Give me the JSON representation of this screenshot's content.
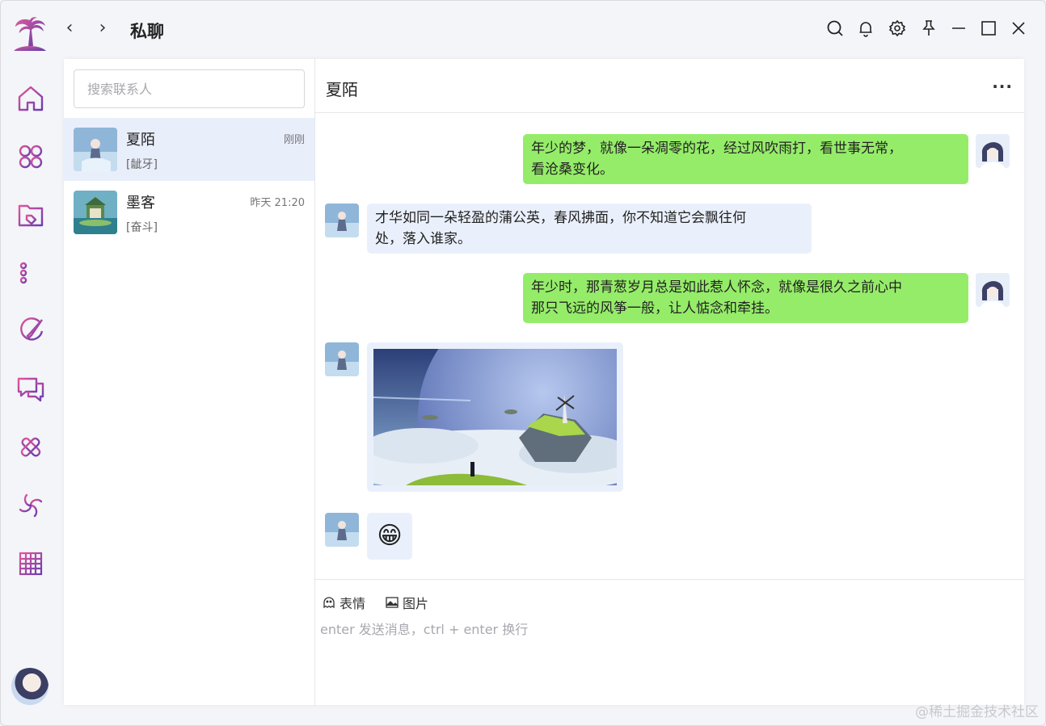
{
  "app": {
    "title": "私聊",
    "watermark": "@稀土掘金技术社区"
  },
  "titlebar": {
    "icons": [
      "search-icon",
      "bell-icon",
      "gear-icon",
      "pin-icon",
      "minimize-icon",
      "maximize-icon",
      "close-icon"
    ]
  },
  "rail": {
    "items": [
      "home-icon",
      "apps-icon",
      "folder-tag-icon",
      "filter-list-icon",
      "brush-icon",
      "chat-bubbles-icon",
      "tools-icon",
      "spiral-icon",
      "grid-icon"
    ]
  },
  "contacts": {
    "search_placeholder": "搜索联系人",
    "items": [
      {
        "name": "夏陌",
        "time": "刚刚",
        "preview": "[龇牙]"
      },
      {
        "name": "墨客",
        "time": "昨天 21:20",
        "preview": "[奋斗]"
      }
    ]
  },
  "chat": {
    "title": "夏陌",
    "more": "···",
    "messages": [
      {
        "side": "me",
        "text_1": "年少的梦，就像一朵凋零的花，经过风吹雨打，看世事无常，",
        "text_2": "看沧桑变化。"
      },
      {
        "side": "them",
        "text_1": "才华如同一朵轻盈的蒲公英，春风拂面，你不知道它会飘往何",
        "text_2": "处，落入谁家。"
      },
      {
        "side": "me",
        "text_1": "年少时，那青葱岁月总是如此惹人怀念，就像是很久之前心中",
        "text_2": "那只飞远的风筝一般，让人惦念和牵挂。"
      },
      {
        "side": "them",
        "type": "image"
      },
      {
        "side": "them",
        "type": "emoji",
        "emoji": "😁"
      }
    ]
  },
  "composer": {
    "emoji_label": "表情",
    "image_label": "图片",
    "placeholder": "enter 发送消息，ctrl + enter 换行"
  },
  "colors": {
    "accent": "#8a4fb8",
    "my_bubble": "#95ec69",
    "their_bubble": "#eaf0fb"
  }
}
